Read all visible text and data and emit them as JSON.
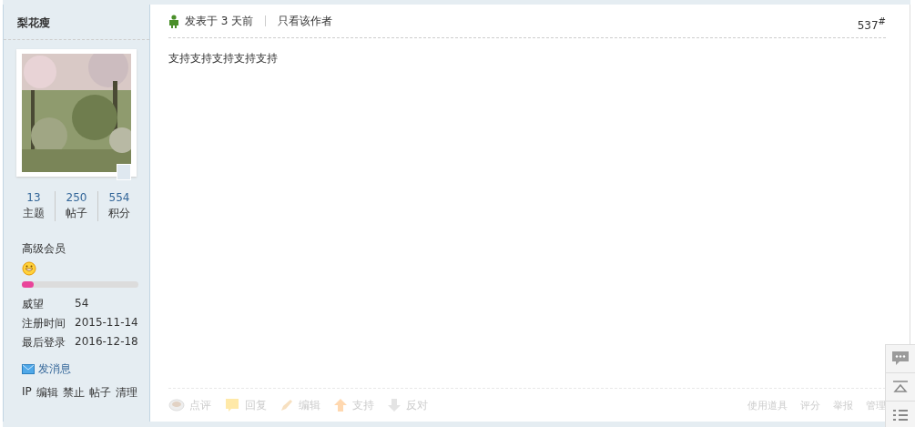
{
  "author": {
    "name": "梨花瘦",
    "stats": [
      {
        "value": "13",
        "label": "主题"
      },
      {
        "value": "250",
        "label": "帖子"
      },
      {
        "value": "554",
        "label": "积分"
      }
    ],
    "group": "高级会员",
    "level": 0.1,
    "profile": [
      {
        "label": "威望",
        "value": "54"
      },
      {
        "label": "注册时间",
        "value": "2015-11-14"
      },
      {
        "label": "最后登录",
        "value": "2016-12-18"
      }
    ],
    "message_link": "发消息",
    "admin_links": [
      "IP",
      "编辑",
      "禁止",
      "帖子",
      "清理"
    ]
  },
  "post": {
    "meta": "发表于 3 天前",
    "author_only": "只看该作者",
    "floor": "537$^{#}$",
    "body": "支持支持支持支持支持",
    "actions": [
      {
        "label": "点评",
        "kind": "comment"
      },
      {
        "label": "回复",
        "kind": "reply"
      },
      {
        "label": "编辑",
        "kind": "edit"
      },
      {
        "label": "支持",
        "kind": "up"
      },
      {
        "label": "反对",
        "kind": "down"
      }
    ],
    "tools": [
      "使用道具",
      "评分",
      "举报",
      "管理"
    ]
  },
  "side_toolbar": [
    {
      "kind": "reply"
    },
    {
      "kind": "top"
    },
    {
      "kind": "list"
    }
  ]
}
